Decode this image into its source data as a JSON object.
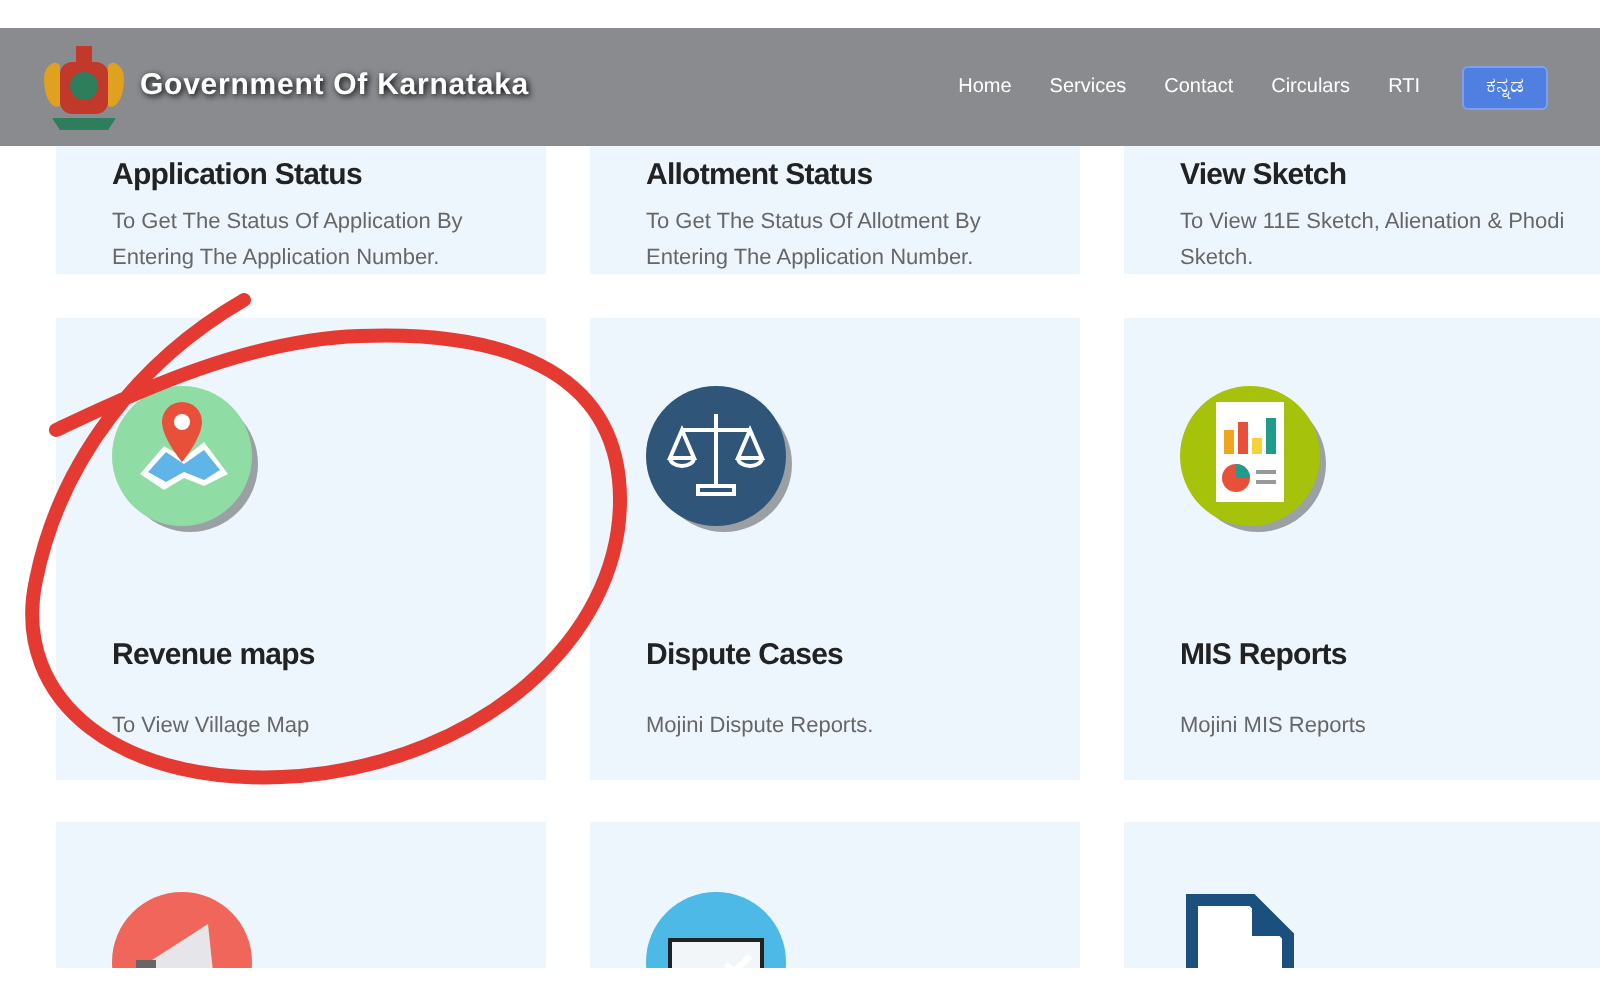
{
  "header": {
    "title": "Government Of Karnataka",
    "nav": [
      {
        "label": "Home"
      },
      {
        "label": "Services"
      },
      {
        "label": "Contact"
      },
      {
        "label": "Circulars"
      },
      {
        "label": "RTI"
      }
    ],
    "language_button": "ಕನ್ನಡ"
  },
  "cards": [
    {
      "kind": "text",
      "title": "Application Status",
      "description": "To Get The Status Of Application By Entering The Application Number."
    },
    {
      "kind": "text",
      "title": "Allotment Status",
      "description": "To Get The Status Of Allotment By Entering The Application Number."
    },
    {
      "kind": "text",
      "title": "View Sketch",
      "description": "To View 11E Sketch, Alienation & Phodi Sketch."
    },
    {
      "kind": "map",
      "title": "Revenue maps",
      "description": "To View Village Map"
    },
    {
      "kind": "scales",
      "title": "Dispute Cases",
      "description": "Mojini Dispute Reports."
    },
    {
      "kind": "report",
      "title": "MIS Reports",
      "description": "Mojini MIS Reports"
    },
    {
      "kind": "megaphone"
    },
    {
      "kind": "monitor"
    },
    {
      "kind": "document"
    }
  ],
  "annotation": {
    "kind": "circle"
  }
}
